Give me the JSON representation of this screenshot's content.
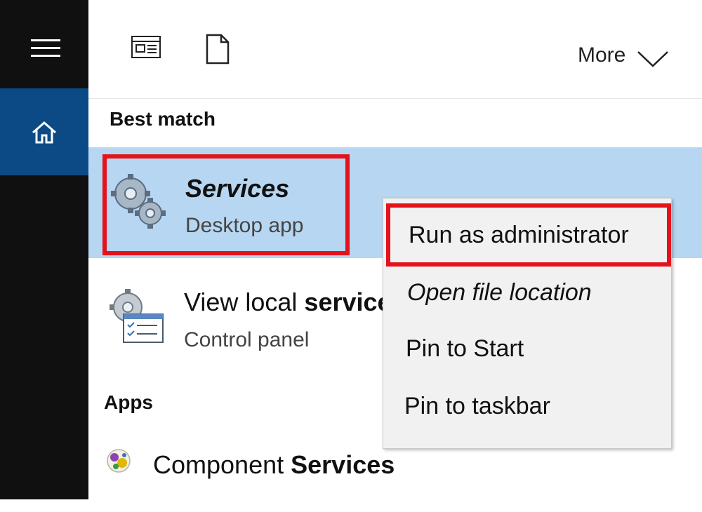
{
  "toolbar": {
    "more_label": "More",
    "icons": [
      "web-preview-icon",
      "document-icon",
      "chevron-down-icon"
    ]
  },
  "sidebar": {
    "icons": [
      "hamburger-menu-icon",
      "home-icon"
    ]
  },
  "best_match": {
    "header": "Best match",
    "item": {
      "title": "Services",
      "subtitle": "Desktop app",
      "icon": "gears-icon"
    }
  },
  "results": {
    "view_local_services": {
      "title_prefix": "View local ",
      "title_bold": "service",
      "subtitle": "Control panel",
      "icon": "services-control-panel-icon"
    }
  },
  "apps": {
    "header": "Apps",
    "items": [
      {
        "title_prefix": "Component ",
        "title_bold": "Services",
        "icon": "component-services-icon"
      }
    ]
  },
  "context_menu": {
    "items": [
      {
        "label": "Run as administrator"
      },
      {
        "label": "Open file location"
      },
      {
        "label": "Pin to Start"
      },
      {
        "label": "Pin to taskbar"
      }
    ]
  },
  "colors": {
    "rail": "#101010",
    "home_highlight": "#0c4a86",
    "selection": "#b7d6f1",
    "annotation_red": "#e3121b",
    "menu_bg": "#f1f1f1"
  }
}
